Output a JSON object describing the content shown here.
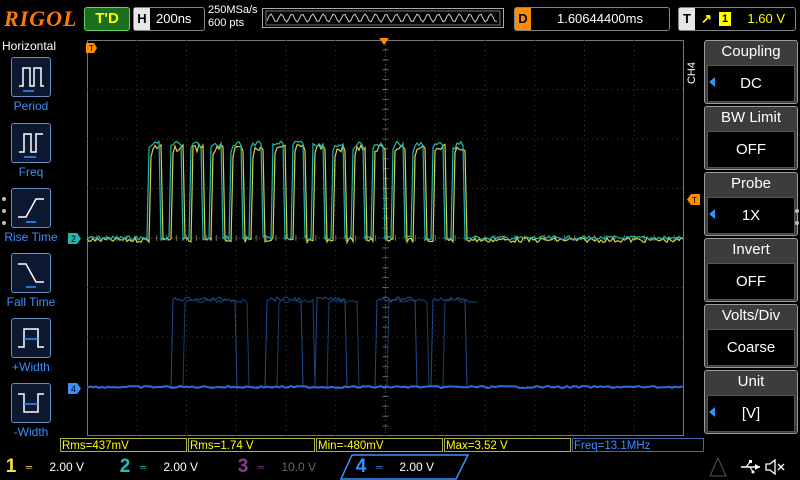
{
  "brand": "RIGOL",
  "trigger_status": "T'D",
  "horizontal": {
    "key": "H",
    "timebase": "200ns",
    "sample_rate": "250MSa/s",
    "memory_depth": "600 pts"
  },
  "delay": {
    "key": "D",
    "value": "1.60644400ms"
  },
  "trigger": {
    "key": "T",
    "edge_icon": "rising-edge-icon",
    "source": "1",
    "level": "1.60 V"
  },
  "left_menu": {
    "title": "Horizontal",
    "items": [
      {
        "label": "Period",
        "icon": "period-icon"
      },
      {
        "label": "Freq",
        "icon": "freq-icon"
      },
      {
        "label": "Rise Time",
        "icon": "rise-time-icon"
      },
      {
        "label": "Fall Time",
        "icon": "fall-time-icon"
      },
      {
        "label": "+Width",
        "icon": "positive-width-icon"
      },
      {
        "label": "-Width",
        "icon": "negative-width-icon"
      }
    ]
  },
  "right_menu": {
    "channel": "CH4",
    "items": [
      {
        "title": "Coupling",
        "value": "DC",
        "has_arrow": true
      },
      {
        "title": "BW Limit",
        "value": "OFF",
        "has_arrow": false
      },
      {
        "title": "Probe",
        "value": "1X",
        "has_arrow": true
      },
      {
        "title": "Invert",
        "value": "OFF",
        "has_arrow": false
      },
      {
        "title": "Volts/Div",
        "value": "Coarse",
        "has_arrow": false
      },
      {
        "title": "Unit",
        "value": "[V]",
        "has_arrow": true
      }
    ]
  },
  "markers": {
    "trigger_time": "T",
    "ch2": "2",
    "ch4": "4",
    "trigger_level": "T"
  },
  "measurements": [
    {
      "text": "Rms=437mV",
      "channel": 1
    },
    {
      "text": "Rms=1.74 V",
      "channel": 1
    },
    {
      "text": "Min=-480mV",
      "channel": 1
    },
    {
      "text": "Max=3.52 V",
      "channel": 1
    },
    {
      "text": "Freq=13.1MHz",
      "channel": 4
    }
  ],
  "channels": [
    {
      "num": "1",
      "scale": "2.00 V",
      "color": "#f0e040",
      "active": true
    },
    {
      "num": "2",
      "scale": "2.00 V",
      "color": "#20c0c0",
      "active": true
    },
    {
      "num": "3",
      "scale": "10.0 V",
      "color": "#8a3a8a",
      "active": false
    },
    {
      "num": "4",
      "scale": "2.00 V",
      "color": "#3a8fff",
      "active": true
    }
  ],
  "status_icons": [
    "usb-icon",
    "speaker-muted-icon"
  ],
  "colors": {
    "ch1": "#f0e040",
    "ch2": "#20c0c0",
    "ch3": "#8a3a8a",
    "ch4": "#3a8fff",
    "grid": "#3a3a3a",
    "accent": "#ff8c00"
  }
}
